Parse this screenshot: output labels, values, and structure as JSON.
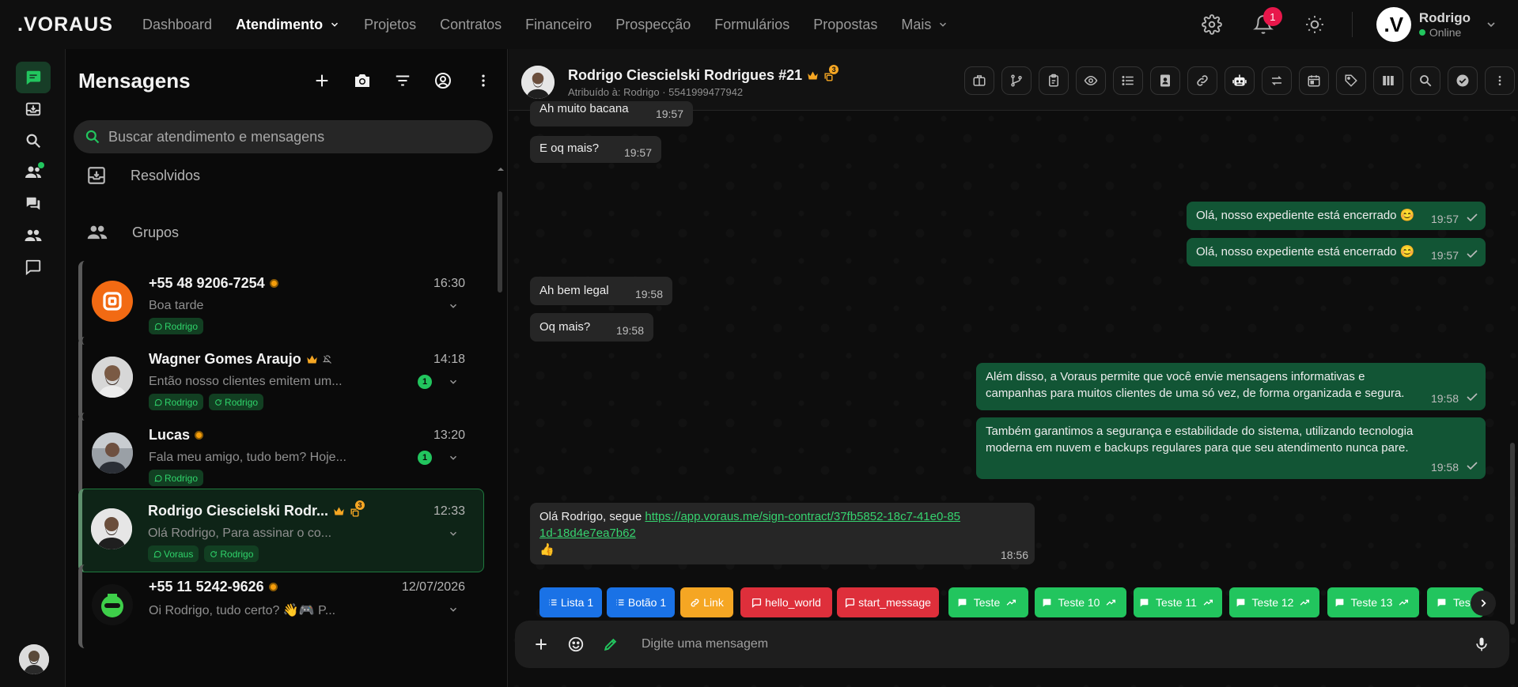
{
  "brand": ".VORAUS",
  "nav": [
    {
      "label": "Dashboard",
      "active": false
    },
    {
      "label": "Atendimento",
      "active": true
    },
    {
      "label": "Projetos",
      "active": false
    },
    {
      "label": "Contratos",
      "active": false
    },
    {
      "label": "Financeiro",
      "active": false
    },
    {
      "label": "Prospecção",
      "active": false
    },
    {
      "label": "Formulários",
      "active": false
    },
    {
      "label": "Propostas",
      "active": false
    },
    {
      "label": "Mais",
      "active": false
    }
  ],
  "topbar": {
    "notification_count": "1",
    "user": {
      "initial": ".V",
      "name": "Rodrigo",
      "status": "Online"
    }
  },
  "colors": {
    "accent": "#22c55e",
    "accent_dark": "#125535",
    "danger": "#e8174b",
    "away": "#f59e0b"
  },
  "list": {
    "title": "Mensagens",
    "search_placeholder": "Buscar atendimento e mensagens",
    "sections": [
      {
        "label": "Resolvidos",
        "icon": "archive-icon"
      },
      {
        "label": "Grupos",
        "icon": "group-icon"
      }
    ],
    "conversations": [
      {
        "name": "+55 48 9206-7254",
        "time": "16:30",
        "preview": "Boa tarde",
        "tags": [
          {
            "icon": "whatsapp-icon",
            "label": "Rodrigo"
          }
        ],
        "unread": "",
        "avatar": "orange-logo"
      },
      {
        "name": "Wagner Gomes Araujo",
        "time": "14:18",
        "preview": "Então nosso clientes emitem um...",
        "tags": [
          {
            "icon": "whatsapp-icon",
            "label": "Rodrigo"
          },
          {
            "icon": "assign-icon",
            "label": "Rodrigo"
          }
        ],
        "unread": "1",
        "avatar": "photo"
      },
      {
        "name": "Lucas",
        "time": "13:20",
        "preview": "Fala meu amigo, tudo bem? Hoje...",
        "tags": [
          {
            "icon": "whatsapp-icon",
            "label": "Rodrigo"
          }
        ],
        "unread": "1",
        "avatar": "photo"
      },
      {
        "name": "Rodrigo Ciescielski Rodr...",
        "time": "12:33",
        "preview": "Olá Rodrigo, Para assinar o co...",
        "tags": [
          {
            "icon": "whatsapp-icon",
            "label": "Voraus"
          },
          {
            "icon": "assign-icon",
            "label": "Rodrigo"
          }
        ],
        "unread": "",
        "badge": "3",
        "avatar": "photo"
      },
      {
        "name": "+55 11 5242-9626",
        "time": "12/07/2026",
        "preview": "Oi Rodrigo, tudo certo? 👋🎮 P...",
        "tags": [],
        "unread": "",
        "avatar": "green-logo"
      }
    ]
  },
  "chat": {
    "title": "Rodrigo Ciescielski Rodrigues #21",
    "title_badge": "3",
    "subtitle": "Atribuído à: Rodrigo · 5541999477942",
    "messages": [
      {
        "dir": "in",
        "text": "Ah muito bacana",
        "time": "19:57"
      },
      {
        "dir": "in",
        "text": "E oq mais?",
        "time": "19:57"
      },
      {
        "dir": "out",
        "text": "Olá, nosso expediente está encerrado 😊",
        "time": "19:57"
      },
      {
        "dir": "out",
        "text": "Olá, nosso expediente está encerrado 😊",
        "time": "19:57"
      },
      {
        "dir": "in",
        "text": "Ah bem legal",
        "time": "19:58"
      },
      {
        "dir": "in",
        "text": "Oq mais?",
        "time": "19:58"
      },
      {
        "dir": "out",
        "text": "Além disso, a Voraus permite que você envie mensagens informativas e campanhas para muitos clientes de uma só vez, de forma organizada e segura.",
        "time": "19:58"
      },
      {
        "dir": "out",
        "text": "Também garantimos a segurança e estabilidade do sistema, utilizando tecnologia moderna em nuvem e backups regulares para que seu atendimento nunca pare.",
        "time": "19:58"
      },
      {
        "dir": "in",
        "text_before": "Olá Rodrigo, segue ",
        "link": "https://app.voraus.me/sign-contract/37fb5852-18c7-41e0-851d-18d4e7ea7b62",
        "text_after": "👍",
        "time": "18:56"
      }
    ],
    "quick_replies": [
      {
        "label": "Lista 1",
        "color": "blue",
        "icon": "list-icon"
      },
      {
        "label": "Botão 1",
        "color": "blue",
        "icon": "list-icon"
      },
      {
        "label": "Link",
        "color": "yellow",
        "icon": "link-icon"
      },
      {
        "label": "hello_world",
        "color": "red",
        "icon": "chat-icon"
      },
      {
        "label": "start_message",
        "color": "red",
        "icon": "chat-icon"
      },
      {
        "label": "Teste",
        "color": "green",
        "icon": "chat-icon"
      },
      {
        "label": "Teste 10",
        "color": "green",
        "icon": "chat-icon"
      },
      {
        "label": "Teste 11",
        "color": "green",
        "icon": "chat-icon"
      },
      {
        "label": "Teste 12",
        "color": "green",
        "icon": "chat-icon"
      },
      {
        "label": "Teste 13",
        "color": "green",
        "icon": "chat-icon"
      },
      {
        "label": "Teste",
        "color": "green",
        "icon": "chat-icon"
      }
    ],
    "composer_placeholder": "Digite uma mensagem"
  }
}
